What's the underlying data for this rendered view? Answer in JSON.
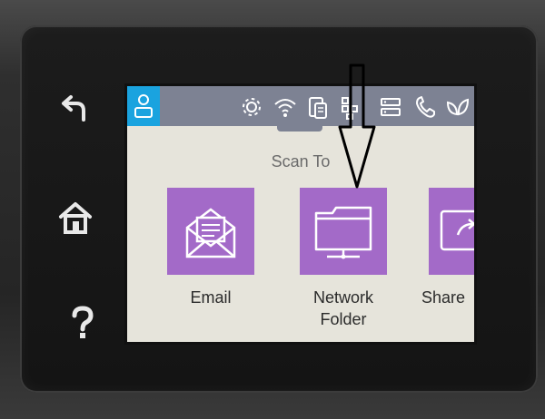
{
  "screen": {
    "title": "Scan To",
    "options": [
      {
        "label_line1": "Email",
        "label_line2": "",
        "icon": "envelope-icon"
      },
      {
        "label_line1": "Network",
        "label_line2": "Folder",
        "icon": "network-folder-icon"
      },
      {
        "label_line1": "Share",
        "label_line2": "",
        "icon": "share-icon"
      }
    ]
  },
  "status_icons": [
    "user-icon",
    "settings-icon",
    "wifi-icon",
    "wifi-direct-icon",
    "network-icon",
    "usb-icon",
    "fax-icon",
    "eco-icon"
  ],
  "side_buttons": [
    "back-icon",
    "home-icon",
    "help-icon"
  ],
  "colors": {
    "tile": "#a36ac8",
    "status_bar": "#7d8293",
    "user_tile": "#1aa3df",
    "screen_bg": "#e6e4db"
  }
}
